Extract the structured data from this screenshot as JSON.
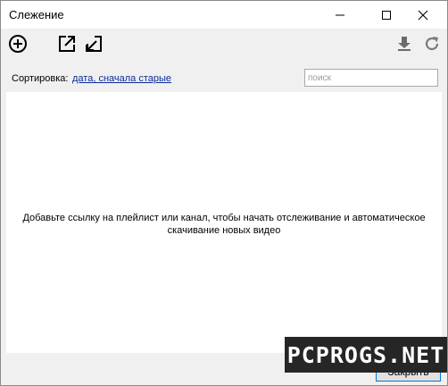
{
  "window": {
    "title": "Слежение"
  },
  "toolbar": {
    "icons": [
      "add-icon",
      "export-icon",
      "import-icon",
      "download-icon",
      "refresh-icon"
    ]
  },
  "sort": {
    "label": "Сортировка:",
    "value": "дата, сначала старые"
  },
  "search": {
    "placeholder": "поиск",
    "value": ""
  },
  "content": {
    "empty_message": "Добавьте ссылку на плейлист или канал, чтобы начать отслеживание и автоматическое скачивание новых видео"
  },
  "footer": {
    "close_label": "Закрыть"
  },
  "watermark": {
    "text": "PCPROGS.NET"
  },
  "colors": {
    "link": "#0b2b9a",
    "button_border": "#0078d7",
    "background": "#f0f0f0"
  }
}
